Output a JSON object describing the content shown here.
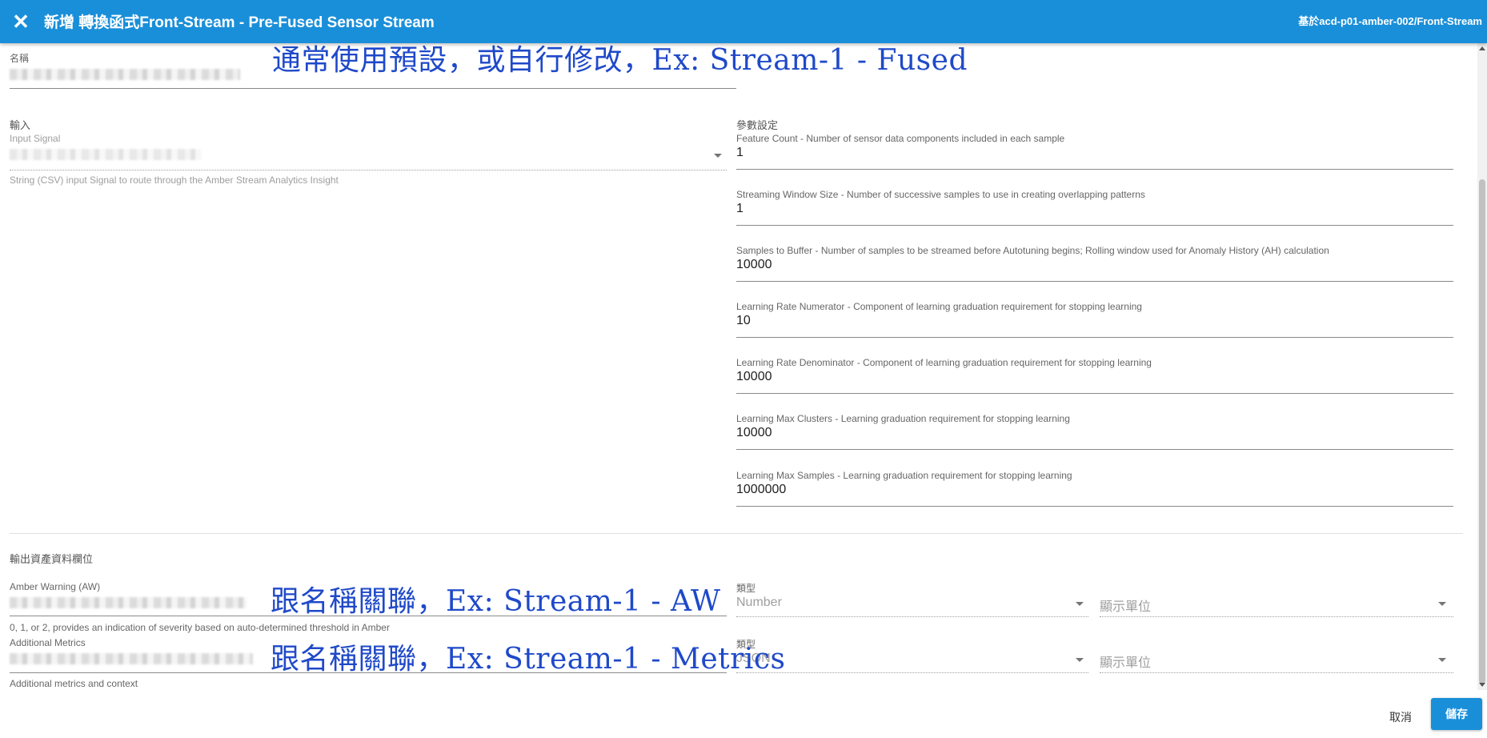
{
  "header": {
    "close_icon": "close-icon",
    "title": "新增 轉換函式Front-Stream - Pre-Fused Sensor Stream",
    "path": "基於acd-p01-amber-002/Front-Stream"
  },
  "name_field": {
    "label": "名稱"
  },
  "input_section": {
    "title": "輸入",
    "field_label": "Input Signal",
    "hint": "String (CSV) input Signal to route through the Amber Stream Analytics Insight"
  },
  "params": {
    "title": "參數設定",
    "items": [
      {
        "label": "Feature Count - Number of sensor data components included in each sample",
        "value": "1"
      },
      {
        "label": "Streaming Window Size - Number of successive samples to use in creating overlapping patterns",
        "value": "1"
      },
      {
        "label": "Samples to Buffer - Number of samples to be streamed before Autotuning begins; Rolling window used for Anomaly History (AH) calculation",
        "value": "10000"
      },
      {
        "label": "Learning Rate Numerator - Component of learning graduation requirement for stopping learning",
        "value": "10"
      },
      {
        "label": "Learning Rate Denominator - Component of learning graduation requirement for stopping learning",
        "value": "10000"
      },
      {
        "label": "Learning Max Clusters - Learning graduation requirement for stopping learning",
        "value": "10000"
      },
      {
        "label": "Learning Max Samples - Learning graduation requirement for stopping learning",
        "value": "1000000"
      }
    ]
  },
  "output_section": {
    "title": "輸出資產資料欄位",
    "rows": [
      {
        "label": "Amber Warning (AW)",
        "hint": "0, 1, or 2, provides an indication of severity based on auto-determined threshold in Amber",
        "type_label": "類型",
        "type_value": "Number",
        "unit_placeholder": "顯示單位"
      },
      {
        "label": "Additional Metrics",
        "hint": "Additional metrics and context",
        "type_label": "類型",
        "type_value": "JSON",
        "unit_placeholder": "顯示單位"
      }
    ]
  },
  "annotations": {
    "name_note": "通常使用預設，或自行修改，Ex: Stream-1 - Fused",
    "aw_note": "跟名稱關聯，Ex: Stream-1 - AW",
    "metrics_note": "跟名稱關聯，Ex: Stream-1 - Metrics",
    "color": "#1f49c9"
  },
  "footer": {
    "cancel_label": "取消",
    "save_label": "儲存"
  },
  "colors": {
    "accent": "#1a8fd9"
  }
}
